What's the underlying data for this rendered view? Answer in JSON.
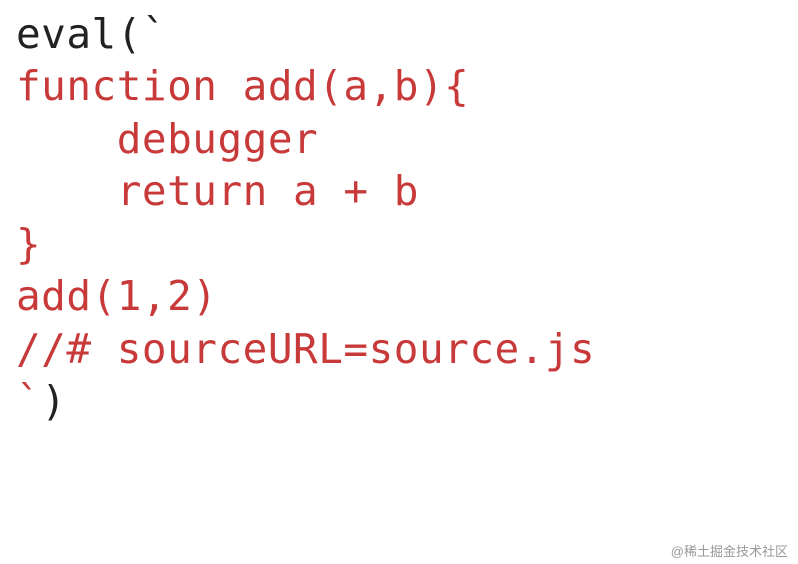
{
  "code": {
    "l1_eval": "eval(`",
    "l2": "function add(a,b){",
    "l3": "    debugger",
    "l4": "    return a + b",
    "l5": "}",
    "l6": "add(1,2)",
    "l7": "//# sourceURL=source.js",
    "l8_tick": "`",
    "l8_paren": ")"
  },
  "watermark": "@稀土掘金技术社区"
}
